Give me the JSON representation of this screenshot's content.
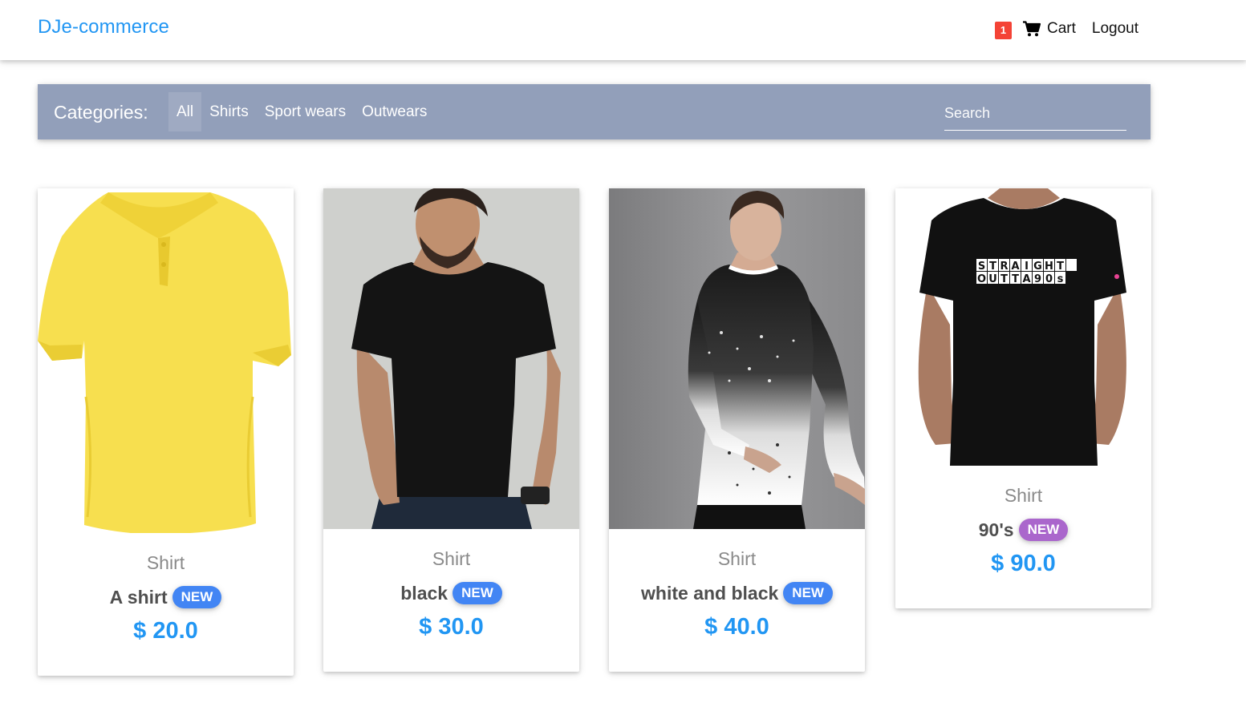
{
  "navbar": {
    "brand": "DJe-commerce",
    "cart_count": "1",
    "cart_label": "Cart",
    "logout_label": "Logout"
  },
  "categories": {
    "title": "Categories:",
    "items": [
      {
        "label": "All",
        "active": true
      },
      {
        "label": "Shirts",
        "active": false
      },
      {
        "label": "Sport wears",
        "active": false
      },
      {
        "label": "Outwears",
        "active": false
      }
    ],
    "search_placeholder": "Search"
  },
  "products": [
    {
      "category": "Shirt",
      "title": "A shirt",
      "badge": "NEW",
      "badge_color": "#4285f4",
      "price": "$ 20.0",
      "image": "yellow polo shirt"
    },
    {
      "category": "Shirt",
      "title": "black",
      "badge": "NEW",
      "badge_color": "#4285f4",
      "price": "$ 30.0",
      "image": "man in black t-shirt"
    },
    {
      "category": "Shirt",
      "title": "white and black",
      "badge": "NEW",
      "badge_color": "#4285f4",
      "price": "$ 40.0",
      "image": "man in white and black splatter long-sleeve"
    },
    {
      "category": "Shirt",
      "title": "90's",
      "badge": "NEW",
      "badge_color": "#aa66cc",
      "price": "$ 90.0",
      "image": "black t-shirt with straight outta 90s print"
    }
  ],
  "colors": {
    "accent": "#2196f3",
    "category_bar": "#929fba",
    "cart_badge": "#f44336"
  }
}
